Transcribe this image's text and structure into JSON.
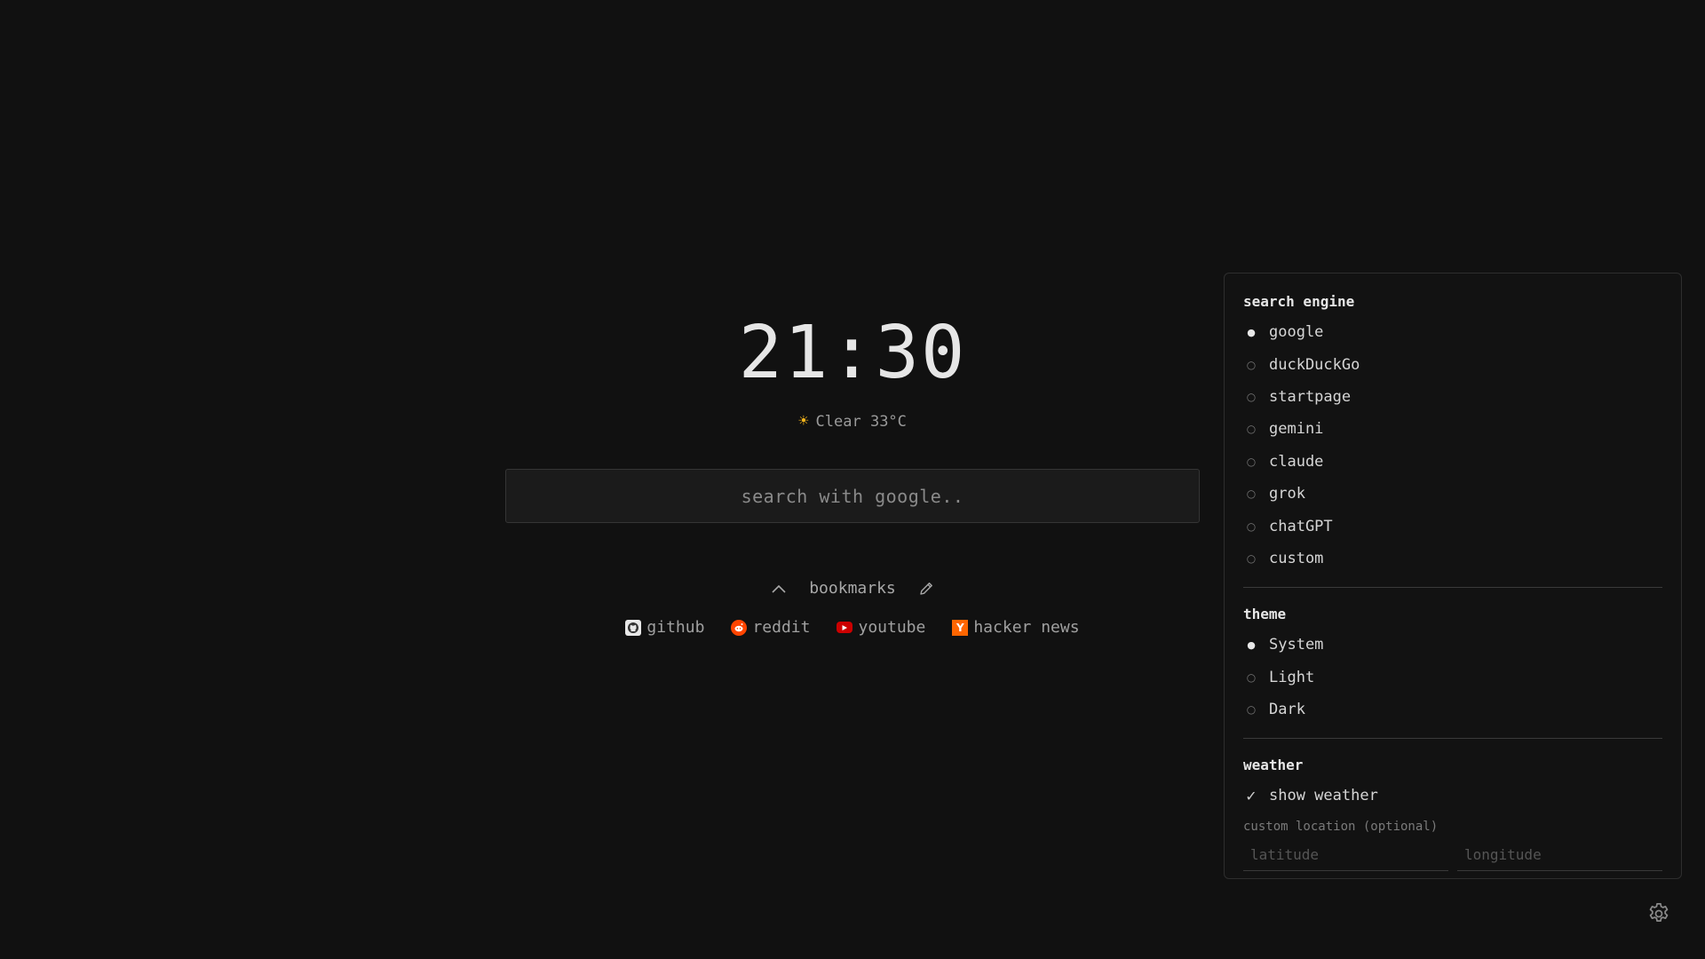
{
  "clock": {
    "time": "21:30"
  },
  "weather": {
    "icon": "sun-icon",
    "summary": "Clear 33°C"
  },
  "search": {
    "placeholder": "search with google.."
  },
  "bookmarks": {
    "header_label": "bookmarks",
    "items": [
      {
        "label": "github",
        "icon": "github-icon"
      },
      {
        "label": "reddit",
        "icon": "reddit-icon"
      },
      {
        "label": "youtube",
        "icon": "youtube-icon"
      },
      {
        "label": "hacker news",
        "icon": "hacker-news-icon",
        "glyph": "Y"
      }
    ]
  },
  "settings": {
    "search_engine": {
      "title": "search engine",
      "options": [
        "google",
        "duckDuckGo",
        "startpage",
        "gemini",
        "claude",
        "grok",
        "chatGPT",
        "custom"
      ],
      "selected": "google"
    },
    "theme": {
      "title": "theme",
      "options": [
        "System",
        "Light",
        "Dark"
      ],
      "selected": "System"
    },
    "weather": {
      "title": "weather",
      "show_weather_label": "show weather",
      "show_weather_checked": true,
      "custom_location_label": "custom location (optional)",
      "latitude_placeholder": "latitude",
      "longitude_placeholder": "longitude"
    }
  },
  "colors": {
    "background": "#111111",
    "sun": "#f5b51c",
    "reddit": "#ff4500",
    "youtube": "#cc0000",
    "hacker_news": "#ff6600"
  }
}
